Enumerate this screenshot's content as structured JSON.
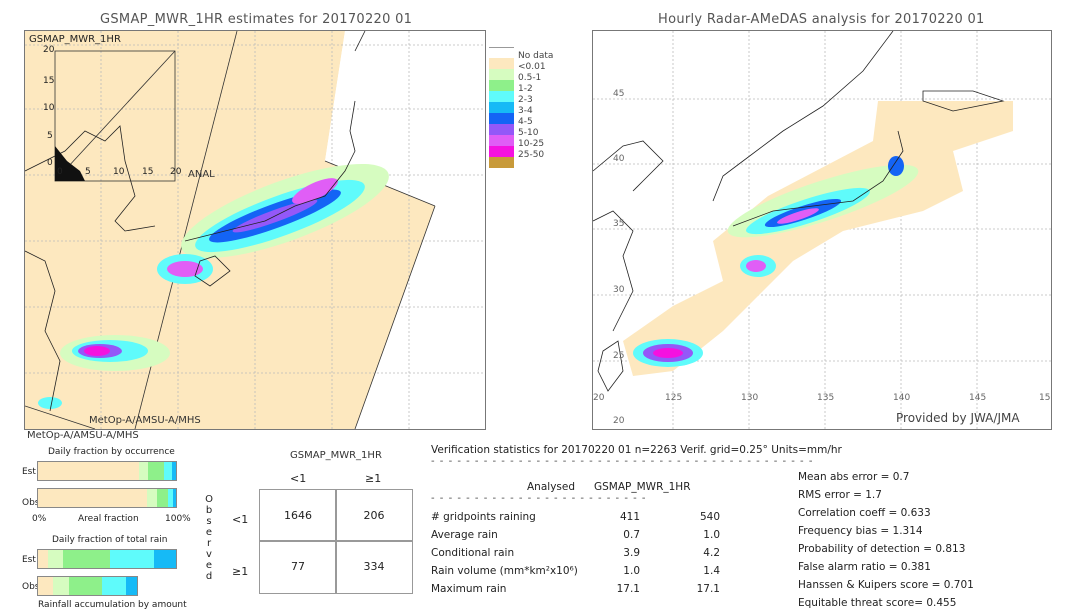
{
  "left_panel": {
    "title": "GSMAP_MWR_1HR estimates for 20170220 01",
    "inset_label": "GSMAP_MWR_1HR",
    "inset_x_label": "ANAL",
    "inset_ticks_y": [
      "20",
      "15",
      "10",
      "5",
      "0"
    ],
    "inset_ticks_x": [
      "0",
      "5",
      "10",
      "15",
      "20"
    ],
    "satellite_label_inner": "MetOp-A/AMSU-A/MHS",
    "satellite_label_outer": "MetOp-A/AMSU-A/MHS"
  },
  "right_panel": {
    "title": "Hourly Radar-AMeDAS analysis for 20170220 01",
    "lat_ticks": [
      "45",
      "40",
      "35",
      "30",
      "25",
      "20"
    ],
    "lon_ticks": [
      "125",
      "130",
      "135",
      "140",
      "145",
      "15"
    ],
    "lon_first": "20",
    "credit": "Provided by JWA/JMA"
  },
  "legend": {
    "items": [
      {
        "label": "No data",
        "color": "#ffffff"
      },
      {
        "label": "<0.01",
        "color": "#fde8bf"
      },
      {
        "label": "0.5-1",
        "color": "#d6fcc0"
      },
      {
        "label": "1-2",
        "color": "#8ef08a"
      },
      {
        "label": "2-3",
        "color": "#5ffbfb"
      },
      {
        "label": "3-4",
        "color": "#16baf6"
      },
      {
        "label": "4-5",
        "color": "#1464f5"
      },
      {
        "label": "5-10",
        "color": "#9458f8"
      },
      {
        "label": "10-25",
        "color": "#e05ef6"
      },
      {
        "label": "25-50",
        "color": "#f511e0"
      },
      {
        "label": "",
        "color": "#c89a3a"
      }
    ]
  },
  "fraction_charts": {
    "occurrence_title": "Daily fraction by occurrence",
    "est_label": "Est",
    "obs_label": "Obs",
    "axis_left": "0%",
    "axis_mid": "Areal fraction",
    "axis_right": "100%",
    "rain_title": "Daily fraction of total rain",
    "rain_caption": "Rainfall accumulation by amount",
    "occurrence_est": [
      {
        "color": "#fde8bf",
        "fraction": 0.73
      },
      {
        "color": "#d6fcc0",
        "fraction": 0.07
      },
      {
        "color": "#8ef08a",
        "fraction": 0.11
      },
      {
        "color": "#5ffbfb",
        "fraction": 0.06
      },
      {
        "color": "#16baf6",
        "fraction": 0.03
      }
    ],
    "occurrence_obs": [
      {
        "color": "#fde8bf",
        "fraction": 0.79
      },
      {
        "color": "#d6fcc0",
        "fraction": 0.07
      },
      {
        "color": "#8ef08a",
        "fraction": 0.08
      },
      {
        "color": "#5ffbfb",
        "fraction": 0.04
      },
      {
        "color": "#16baf6",
        "fraction": 0.02
      }
    ],
    "rain_est": [
      {
        "color": "#fde8bf",
        "fraction": 0.07
      },
      {
        "color": "#d6fcc0",
        "fraction": 0.11
      },
      {
        "color": "#8ef08a",
        "fraction": 0.34
      },
      {
        "color": "#5ffbfb",
        "fraction": 0.32
      },
      {
        "color": "#16baf6",
        "fraction": 0.16
      }
    ],
    "rain_obs": [
      {
        "color": "#fde8bf",
        "fraction": 0.15
      },
      {
        "color": "#d6fcc0",
        "fraction": 0.16
      },
      {
        "color": "#8ef08a",
        "fraction": 0.33
      },
      {
        "color": "#5ffbfb",
        "fraction": 0.25
      },
      {
        "color": "#16baf6",
        "fraction": 0.11
      }
    ],
    "rain_obs_total_fraction": 0.72
  },
  "contingency": {
    "header": "GSMAP_MWR_1HR",
    "col_labels": [
      "<1",
      "≥1"
    ],
    "row_labels": [
      "<1",
      "≥1"
    ],
    "side_label": [
      "O",
      "b",
      "s",
      "e",
      "r",
      "v",
      "e",
      "d"
    ],
    "cells": [
      [
        "1646",
        "206"
      ],
      [
        "77",
        "334"
      ]
    ]
  },
  "verification": {
    "header": "Verification statistics for 20170220 01   n=2263   Verif. grid=0.25°   Units=mm/hr",
    "col_analysed": "Analysed",
    "col_gsmap": "GSMAP_MWR_1HR",
    "rows": [
      {
        "label": "# gridpoints raining",
        "analysed": "411",
        "gsmap": "540"
      },
      {
        "label": "Average rain",
        "analysed": "0.7",
        "gsmap": "1.0"
      },
      {
        "label": "Conditional rain",
        "analysed": "3.9",
        "gsmap": "4.2"
      },
      {
        "label": "Rain volume (mm*km²x10⁶)",
        "analysed": "1.0",
        "gsmap": "1.4"
      },
      {
        "label": "Maximum rain",
        "analysed": "17.1",
        "gsmap": "17.1"
      }
    ],
    "scores": [
      "Mean abs error = 0.7",
      "RMS error = 1.7",
      "Correlation coeff = 0.633",
      "Frequency bias = 1.314",
      "Probability of detection = 0.813",
      "False alarm ratio = 0.381",
      "Hanssen & Kuipers score = 0.701",
      "Equitable threat score= 0.455"
    ]
  }
}
